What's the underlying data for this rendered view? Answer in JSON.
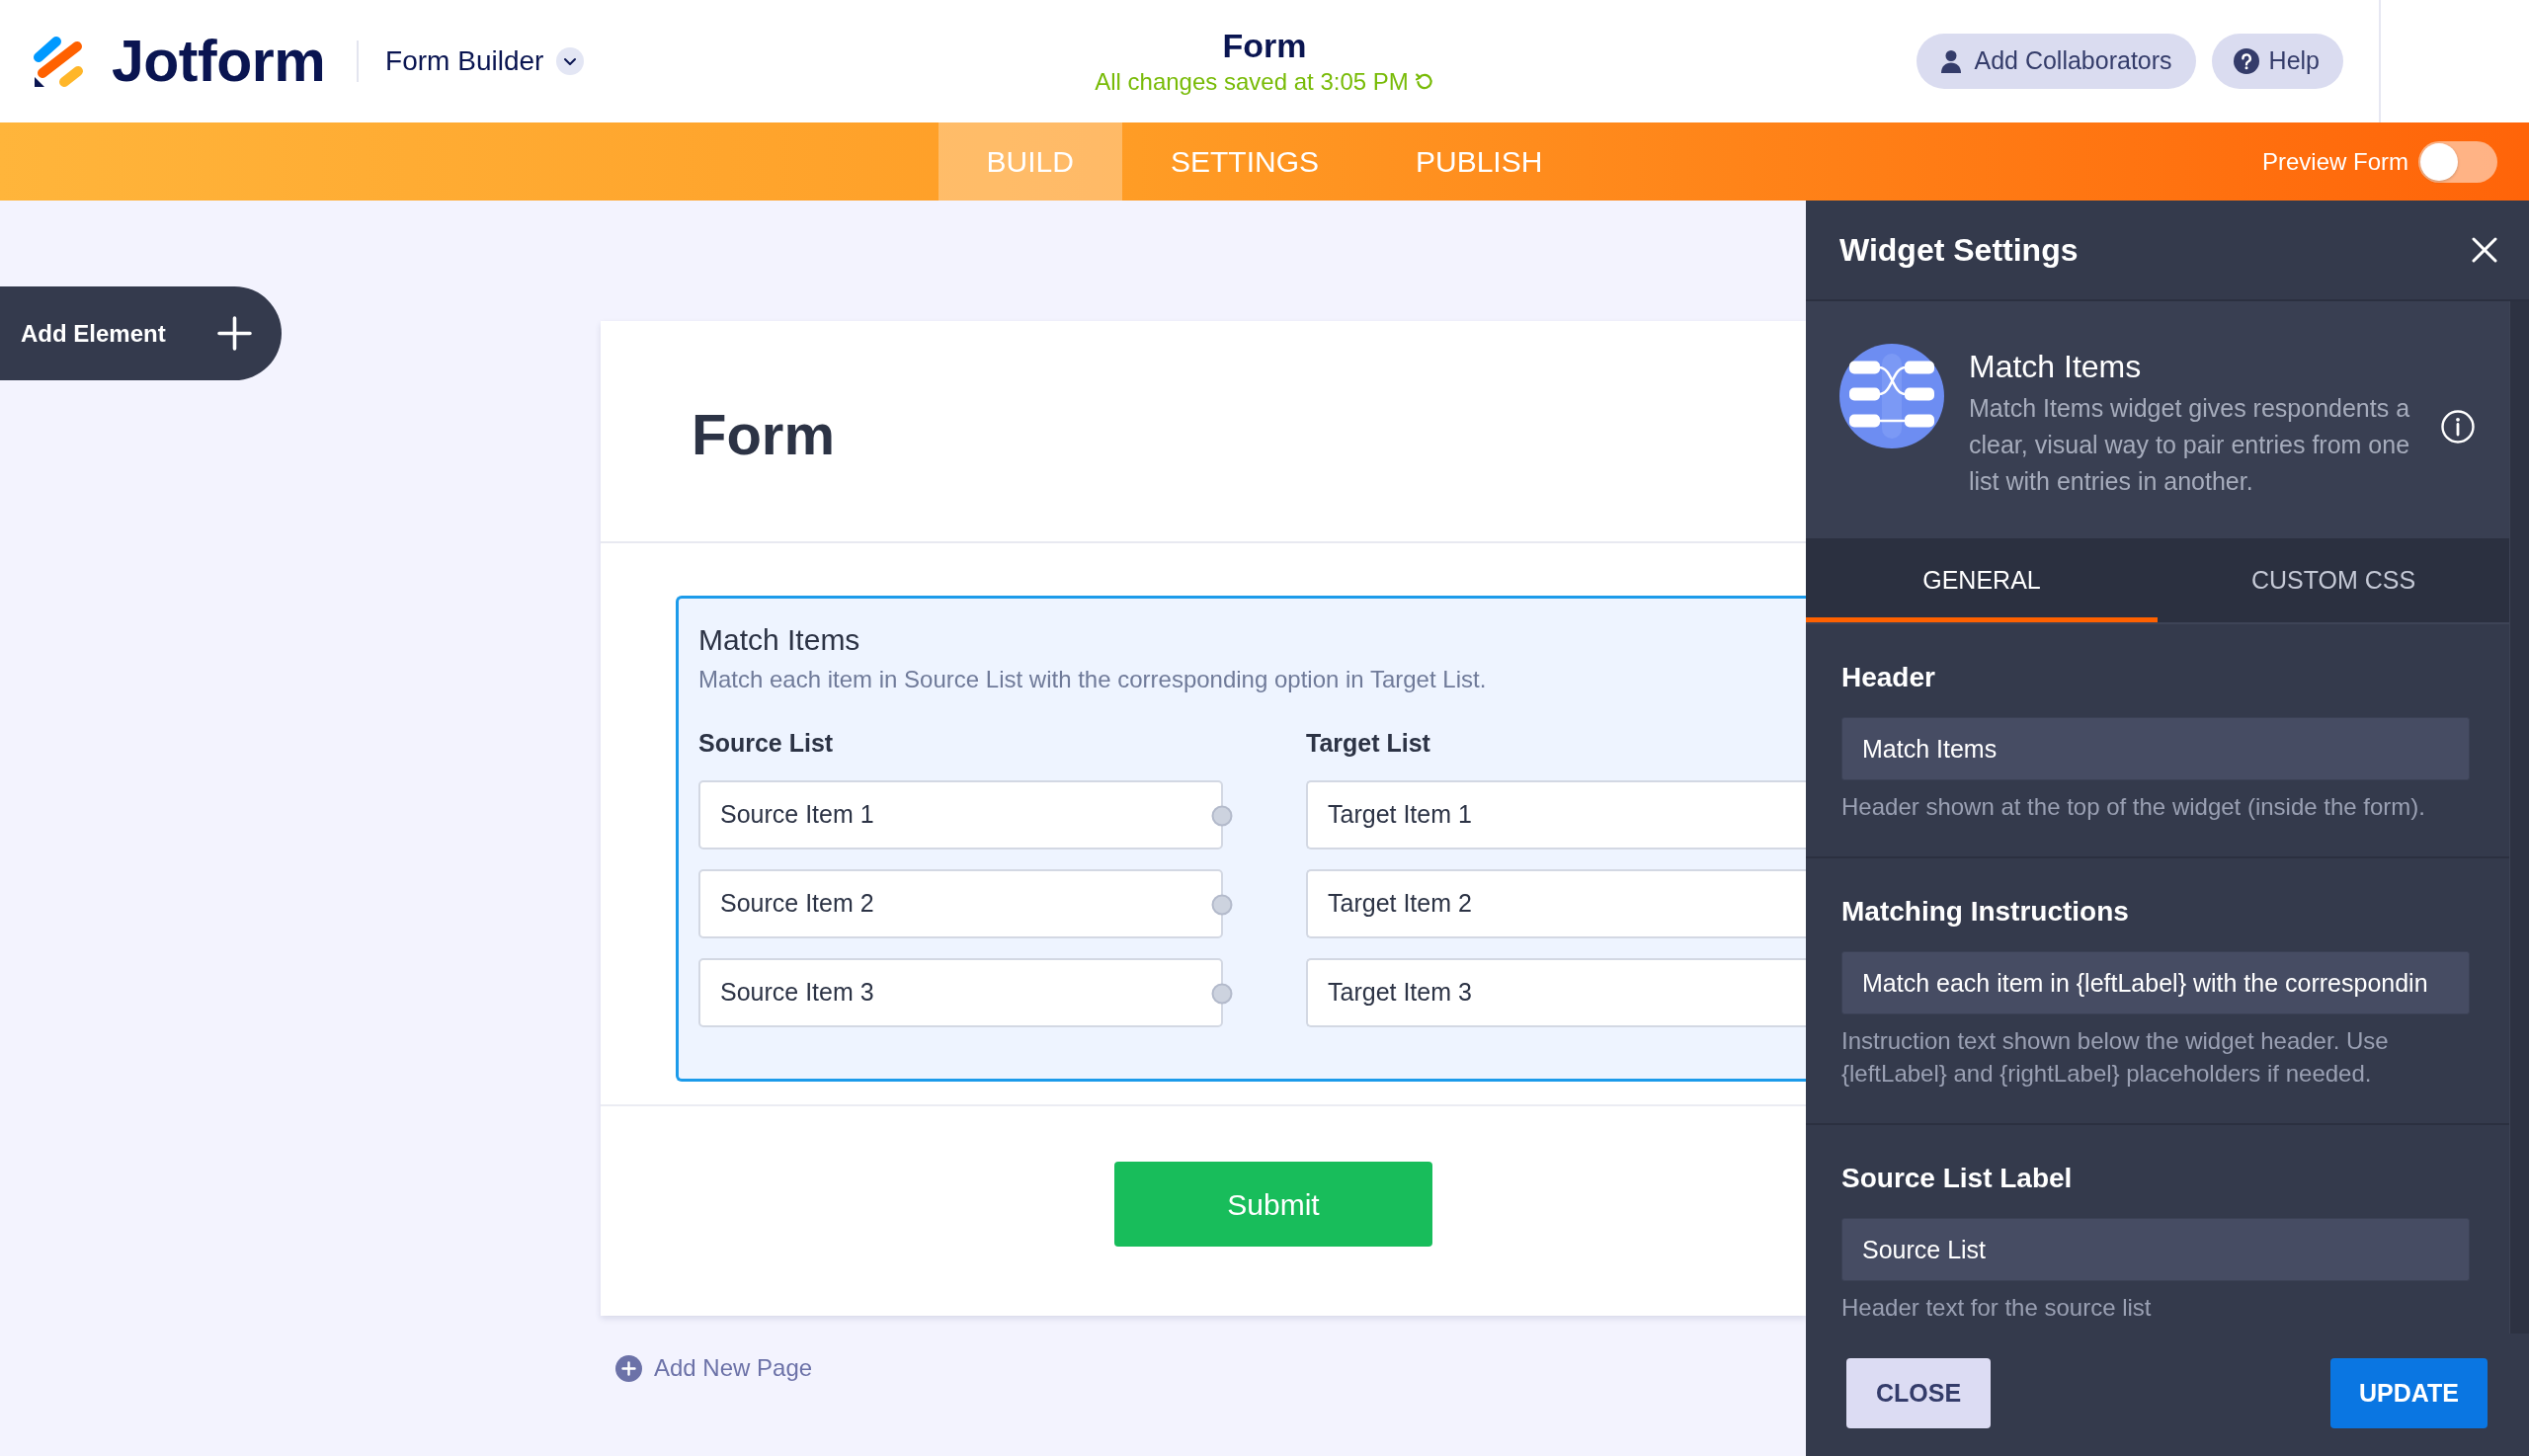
{
  "header": {
    "logo_text": "Jotform",
    "app_menu": "Form Builder",
    "form_title": "Form",
    "save_status": "All changes saved at 3:05 PM",
    "buttons": [
      {
        "kind": "collaborators",
        "label": "Add Collaborators"
      },
      {
        "kind": "help",
        "label": "Help"
      }
    ]
  },
  "nav": {
    "tabs": [
      {
        "label": "BUILD",
        "selected": true
      },
      {
        "label": "SETTINGS",
        "selected": false
      },
      {
        "label": "PUBLISH",
        "selected": false
      }
    ],
    "preview": {
      "label": "Preview Form",
      "on": false
    }
  },
  "sidebar": {
    "add_element": "Add Element"
  },
  "form": {
    "title": "Form",
    "widget": {
      "selected": true,
      "header": "Match Items",
      "instructions": "Match each item in Source List with the corresponding option in Target List.",
      "source_label": "Source List",
      "target_label": "Target List",
      "source_items": [
        "Source Item 1",
        "Source Item 2",
        "Source Item 3"
      ],
      "target_items": [
        "Target Item 1",
        "Target Item 2",
        "Target Item 3"
      ]
    },
    "submit": "Submit",
    "add_page": "Add New Page"
  },
  "widget_settings": {
    "title": "Widget Settings",
    "widget_name": "Match Items",
    "widget_description": "Match Items widget gives respondents a clear, visual way to pair entries from one list with entries in another.",
    "tabs": [
      {
        "label": "GENERAL",
        "selected": true
      },
      {
        "label": "CUSTOM CSS",
        "selected": false
      }
    ],
    "fields": [
      {
        "label": "Header",
        "value": "Match Items",
        "help": "Header shown at the top of the widget (inside the form)."
      },
      {
        "label": "Matching Instructions",
        "value": "Match each item in {leftLabel} with the correspondin",
        "help": "Instruction text shown below the widget header. Use {leftLabel} and {rightLabel} placeholders if needed."
      },
      {
        "label": "Source List Label",
        "value": "Source List",
        "help": "Header text for the source list"
      }
    ],
    "buttons": [
      {
        "kind": "secondary",
        "label": "CLOSE"
      },
      {
        "kind": "primary",
        "label": "UPDATE"
      }
    ]
  }
}
